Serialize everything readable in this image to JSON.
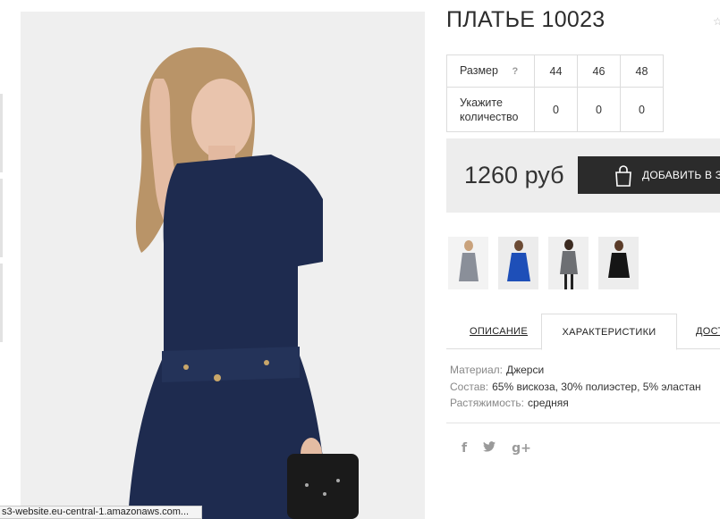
{
  "product": {
    "title": "ПЛАТЬЕ 10023",
    "price": "1260 руб",
    "cart_label": "ДОБАВИТЬ В ЗАКАЗ"
  },
  "size_table": {
    "size_label": "Размер",
    "help_symbol": "?",
    "sizes": [
      "44",
      "46",
      "48"
    ],
    "qty_label": "Укажите количество",
    "quantities": [
      "0",
      "0",
      "0"
    ]
  },
  "tabs": [
    "ОПИСАНИЕ",
    "ХАРАКТЕРИСТИКИ",
    "ДОСТАВКА"
  ],
  "specs": [
    {
      "key": "Материал:",
      "value": "Джерси"
    },
    {
      "key": "Состав:",
      "value": "65% вискоза, 30% полиэстер, 5% эластан"
    },
    {
      "key": "Растяжимость:",
      "value": "средняя"
    }
  ],
  "social": [
    "f",
    "twitter-icon",
    "g+"
  ],
  "status_bar": "s3-website.eu-central-1.amazonaws.com...",
  "colors": {
    "dress_navy": "#1e2b4f",
    "button_dark": "#2b2b2b",
    "price_bg": "#ededed"
  }
}
